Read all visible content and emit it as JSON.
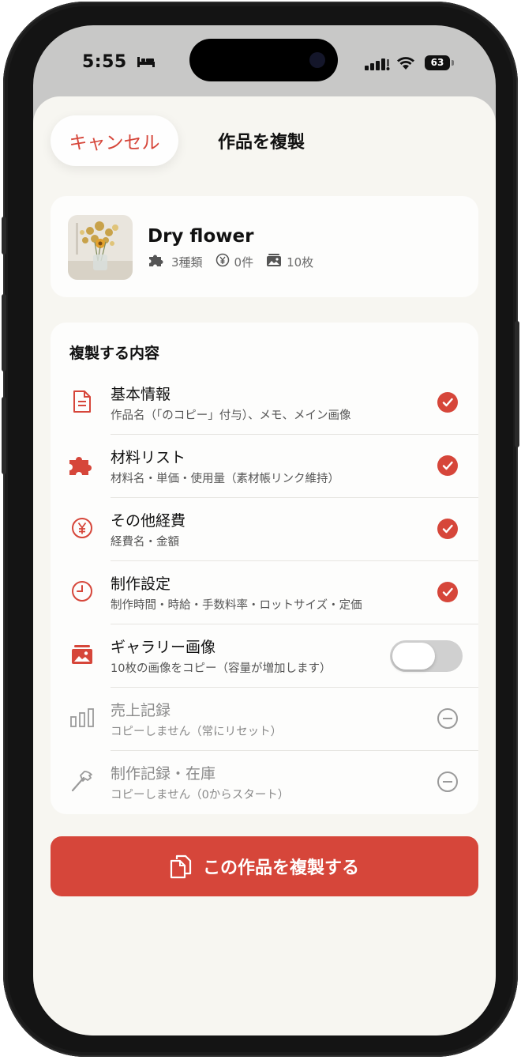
{
  "status_bar": {
    "time": "5:55",
    "battery": "63"
  },
  "header": {
    "cancel_label": "キャンセル",
    "title": "作品を複製"
  },
  "product": {
    "name": "Dry flower",
    "materials": "3種類",
    "expenses": "0件",
    "images": "10枚"
  },
  "section_title": "複製する内容",
  "rows": [
    {
      "title": "基本情報",
      "subtitle": "作品名（「のコピー」付与）、メモ、メイン画像",
      "state": "checked"
    },
    {
      "title": "材料リスト",
      "subtitle": "材料名・単価・使用量（素材帳リンク維持）",
      "state": "checked"
    },
    {
      "title": "その他経費",
      "subtitle": "経費名・金額",
      "state": "checked"
    },
    {
      "title": "制作設定",
      "subtitle": "制作時間・時給・手数料率・ロットサイズ・定価",
      "state": "checked"
    },
    {
      "title": "ギャラリー画像",
      "subtitle": "10枚の画像をコピー（容量が増加します）",
      "state": "toggle-off"
    },
    {
      "title": "売上記録",
      "subtitle": "コピーしません（常にリセット）",
      "state": "excluded"
    },
    {
      "title": "制作記録・在庫",
      "subtitle": "コピーしません（0からスタート）",
      "state": "excluded"
    }
  ],
  "cta_label": "この作品を複製する",
  "colors": {
    "accent": "#d6463a",
    "sheet_bg": "#f7f6f1",
    "card_bg": "#fdfdfc"
  },
  "icons": [
    "document-icon",
    "puzzle-icon",
    "yen-icon",
    "clock-icon",
    "image-icon",
    "bar-chart-icon",
    "hammer-icon",
    "copy-icon"
  ]
}
